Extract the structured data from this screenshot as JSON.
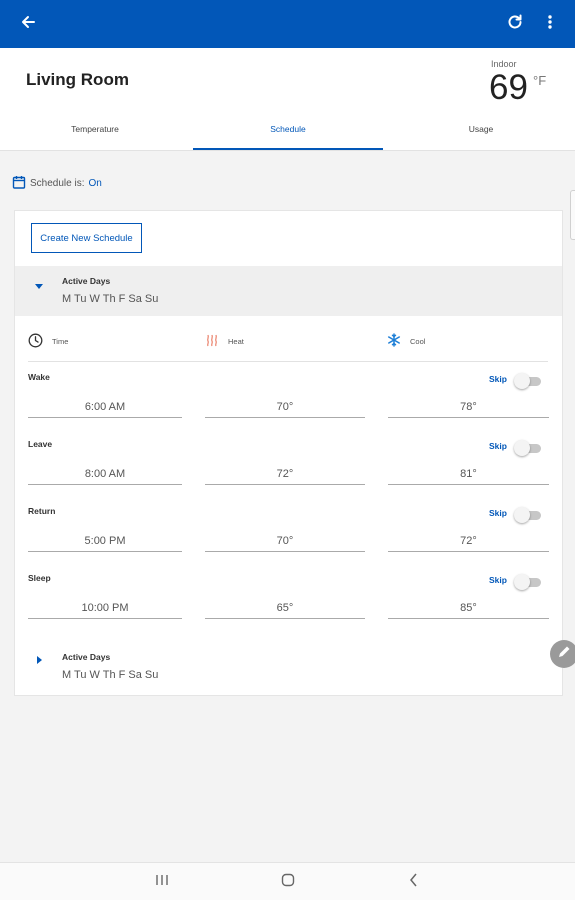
{
  "app": {
    "room_name": "Living Room",
    "indoor_label": "Indoor",
    "indoor_temp": "69",
    "indoor_unit": "°F"
  },
  "tabs": [
    {
      "label": "Temperature",
      "active": false
    },
    {
      "label": "Schedule",
      "active": true
    },
    {
      "label": "Usage",
      "active": false
    }
  ],
  "schedule": {
    "status_label": "Schedule is:",
    "status_value": "On",
    "create_button": "Create New Schedule",
    "columns": {
      "time": "Time",
      "heat": "Heat",
      "cool": "Cool"
    },
    "skip_label": "Skip",
    "groups": [
      {
        "label": "Active Days",
        "days": "M Tu W Th F Sa Su",
        "expanded": true,
        "periods": [
          {
            "name": "Wake",
            "time": "6:00 AM",
            "heat": "70°",
            "cool": "78°",
            "skip": false
          },
          {
            "name": "Leave",
            "time": "8:00 AM",
            "heat": "72°",
            "cool": "81°",
            "skip": false
          },
          {
            "name": "Return",
            "time": "5:00 PM",
            "heat": "70°",
            "cool": "72°",
            "skip": false
          },
          {
            "name": "Sleep",
            "time": "10:00 PM",
            "heat": "65°",
            "cool": "85°",
            "skip": false
          }
        ]
      },
      {
        "label": "Active Days",
        "days": "M Tu W Th F Sa Su",
        "expanded": false
      }
    ]
  },
  "icons": {
    "back": "arrow-back-icon",
    "refresh": "refresh-icon",
    "more": "more-vert-icon",
    "calendar": "calendar-icon",
    "time": "clock-icon",
    "heat": "heat-waves-icon",
    "cool": "snowflake-icon",
    "edit": "pencil-icon"
  },
  "colors": {
    "primary": "#0257b8",
    "heat": "#e8735a",
    "cool": "#1e7fd6"
  }
}
